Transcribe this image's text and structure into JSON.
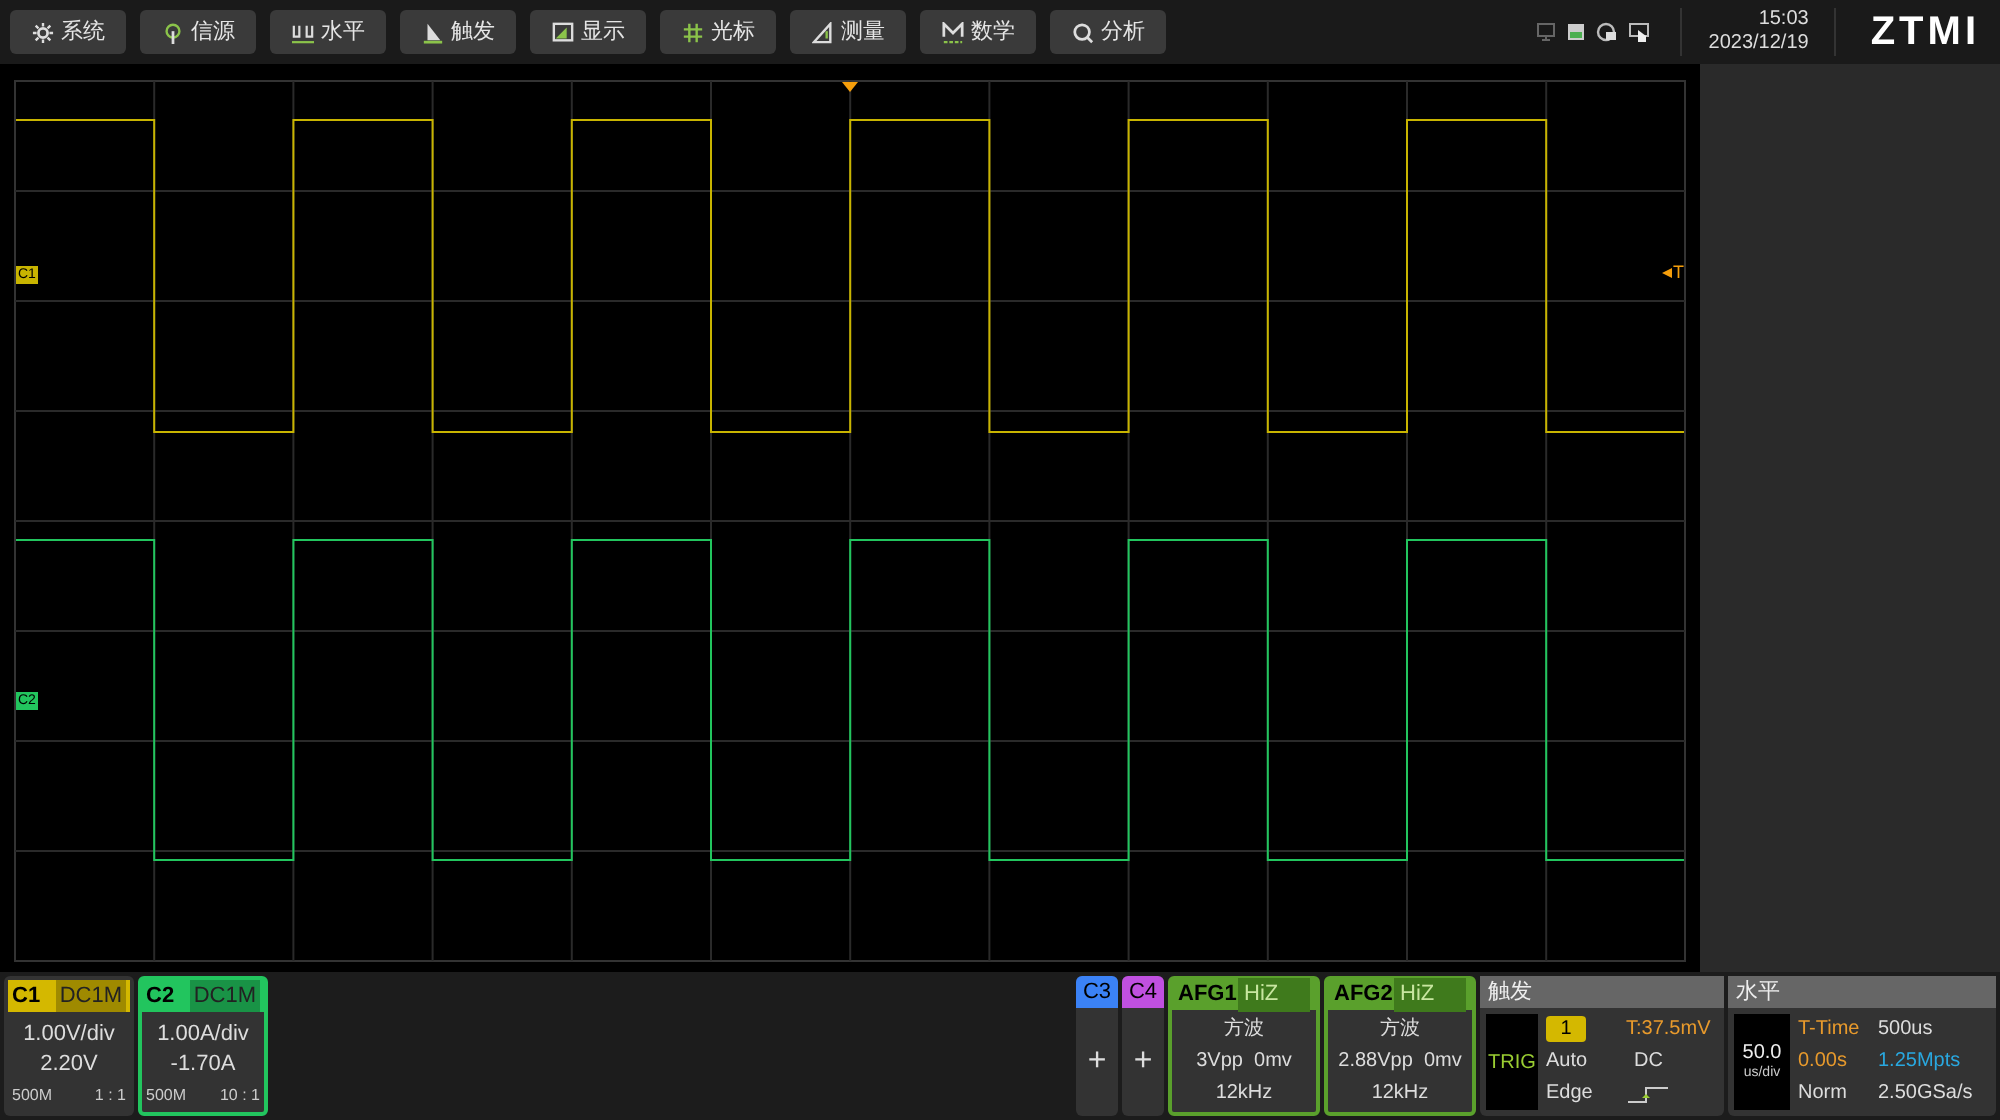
{
  "menu": [
    {
      "label": "系统",
      "kind": "gear"
    },
    {
      "label": "信源",
      "kind": "signal"
    },
    {
      "label": "水平",
      "kind": "wave"
    },
    {
      "label": "触发",
      "kind": "flag"
    },
    {
      "label": "显示",
      "kind": "display"
    },
    {
      "label": "光标",
      "kind": "hash"
    },
    {
      "label": "测量",
      "kind": "ruler"
    },
    {
      "label": "数学",
      "kind": "math"
    },
    {
      "label": "分析",
      "kind": "search"
    }
  ],
  "status": {
    "time": "15:03",
    "date": "2023/12/19",
    "logo": "ZTMI"
  },
  "plot": {
    "markers": [
      {
        "label": "C1",
        "color": "#c8b400"
      },
      {
        "label": "C2",
        "color": "#22c55e"
      }
    ],
    "trigger_label": "T"
  },
  "channels": [
    {
      "name": "C1",
      "coupling": "DC1M",
      "scale": "1.00V/div",
      "offset": "2.20V",
      "bandwidth": "500M",
      "ratio": "1 : 1",
      "color": "#d4b800",
      "selected": false
    },
    {
      "name": "C2",
      "coupling": "DC1M",
      "scale": "1.00A/div",
      "offset": "-1.70A",
      "bandwidth": "500M",
      "ratio": "10 : 1",
      "color": "#22c55e",
      "selected": true
    }
  ],
  "add_channels": [
    {
      "name": "C3",
      "color": "#3b82f6",
      "button": "+"
    },
    {
      "name": "C4",
      "color": "#c050e0",
      "button": "+"
    }
  ],
  "afg": [
    {
      "name": "AFG1",
      "impedance": "HiZ",
      "wave": "方波",
      "amplitude": "3Vpp  0mv",
      "frequency": "12kHz"
    },
    {
      "name": "AFG2",
      "impedance": "HiZ",
      "wave": "方波",
      "amplitude": "2.88Vpp  0mv",
      "frequency": "12kHz"
    }
  ],
  "trigger": {
    "title": "触发",
    "status": "TRIG",
    "source": "1",
    "level": "T:37.5mV",
    "sweep": "Auto",
    "coupling": "DC",
    "type": "Edge"
  },
  "horizontal": {
    "title": "水平",
    "scale": "50.0",
    "scale_unit": "us/div",
    "t_time_label": "T-Time",
    "t_time": "500us",
    "position": "0.00s",
    "memory": "1.25Mpts",
    "mode": "Norm",
    "sample_rate": "2.50GSa/s"
  }
}
